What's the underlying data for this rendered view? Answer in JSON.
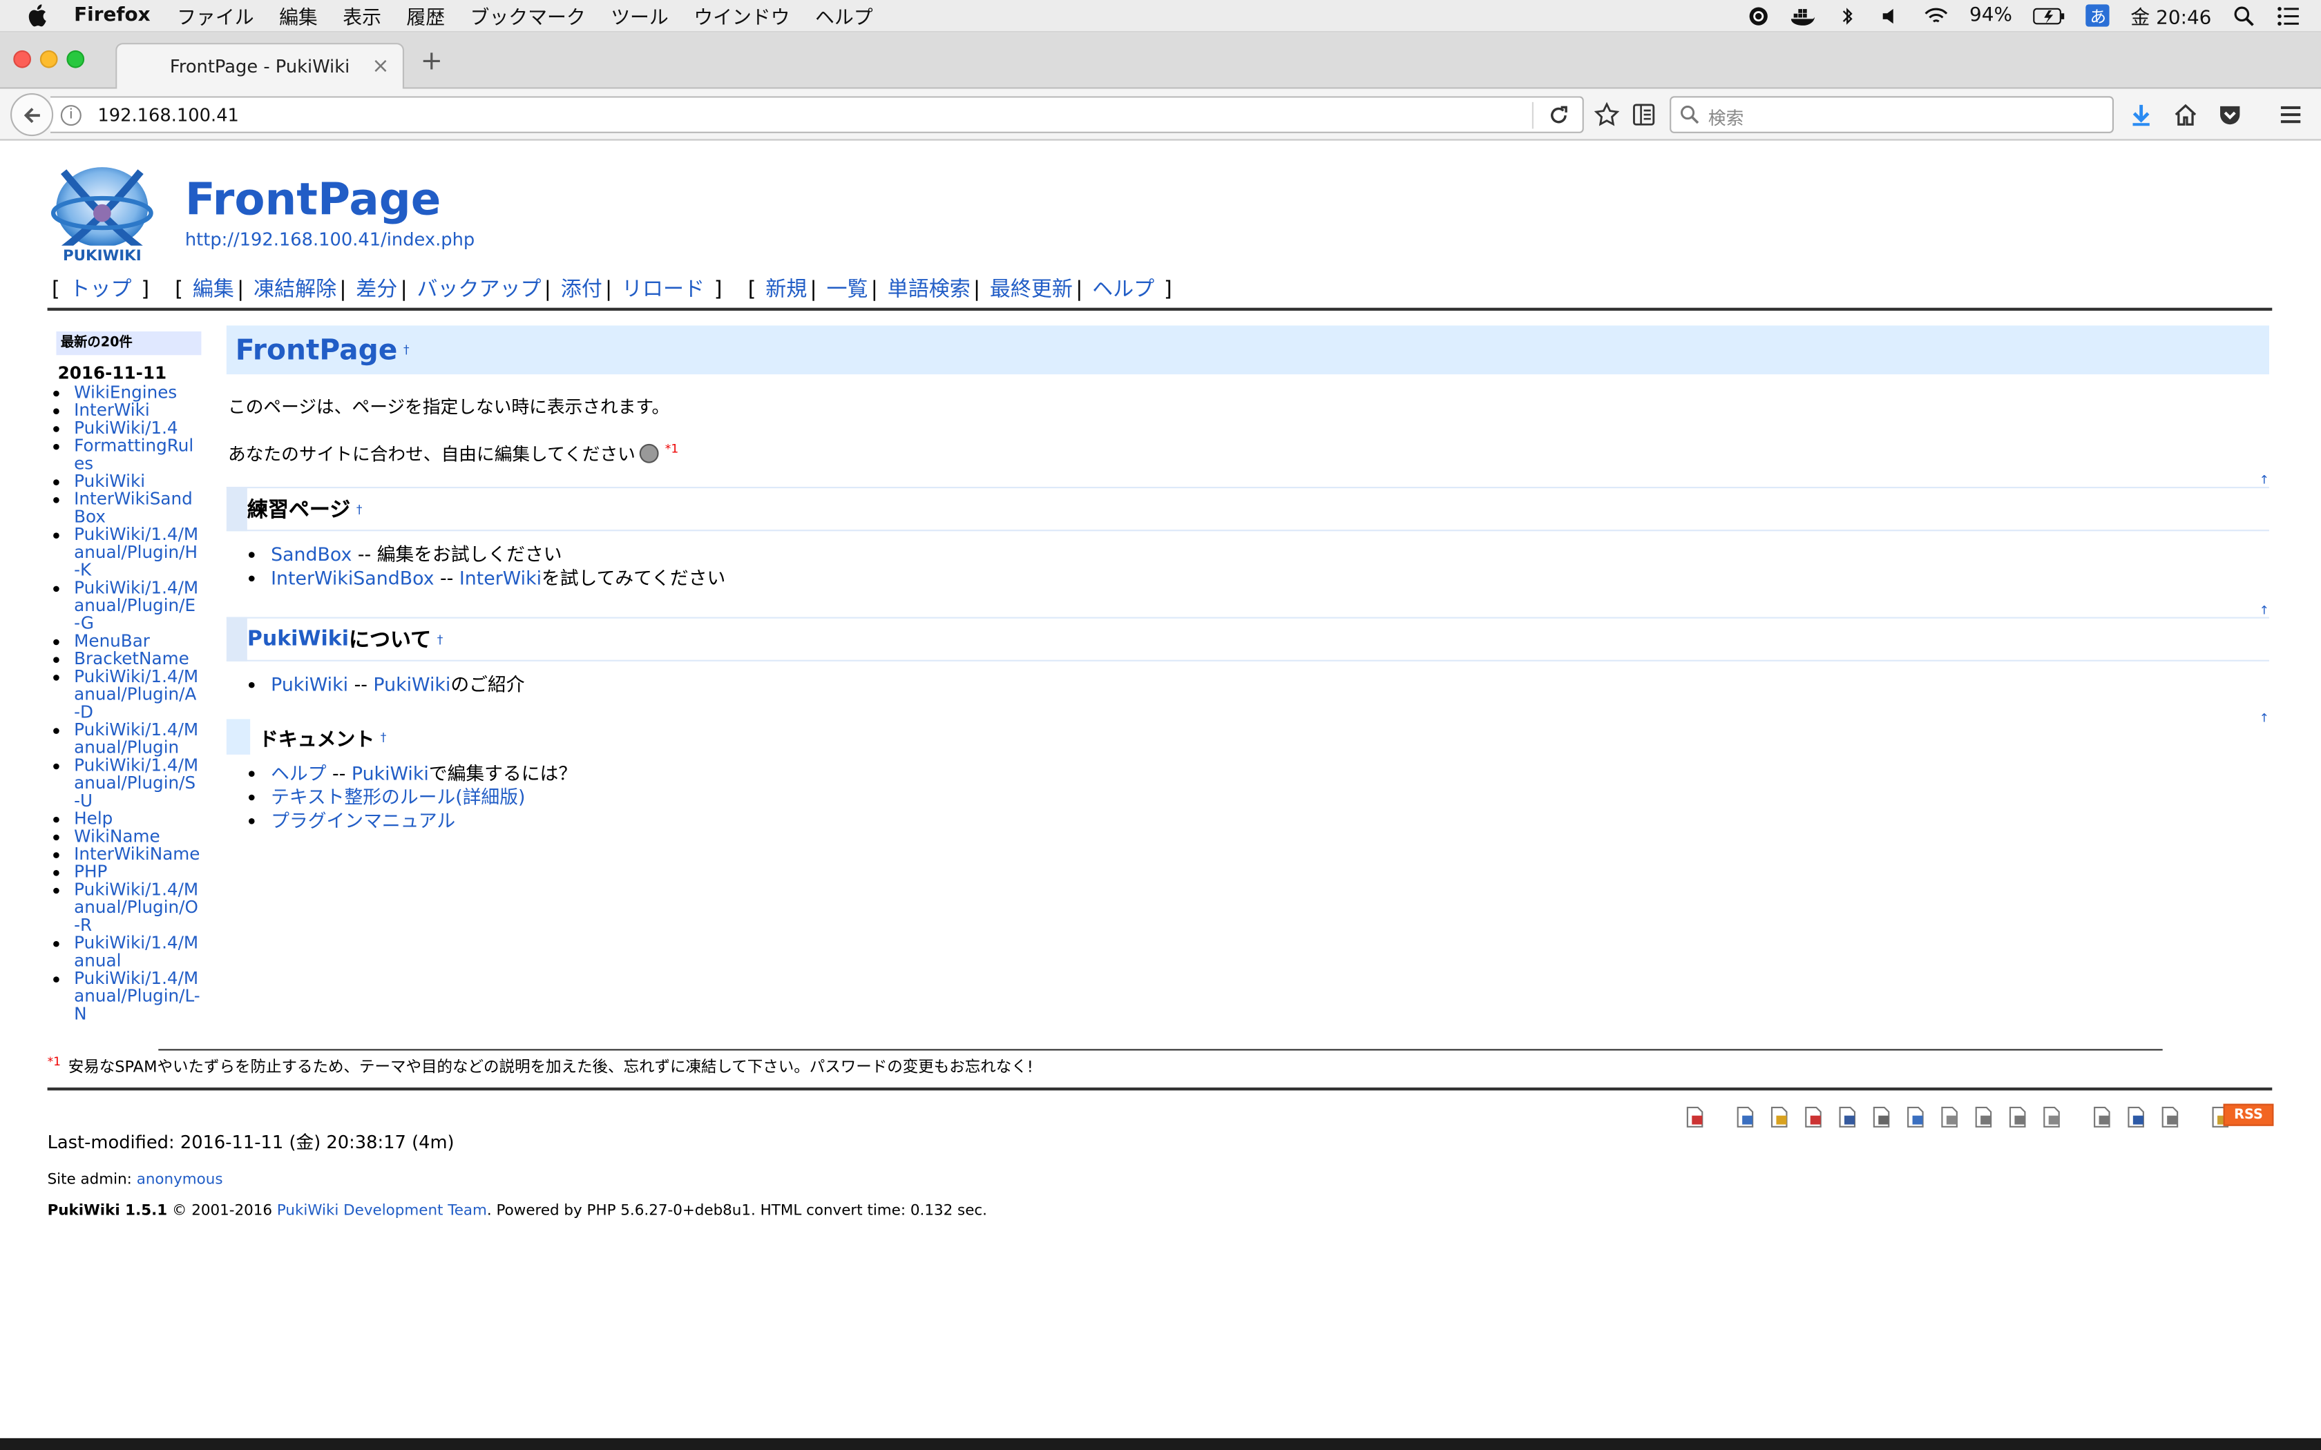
{
  "menubar": {
    "app_name": "Firefox",
    "menus": [
      "ファイル",
      "編集",
      "表示",
      "履歴",
      "ブックマーク",
      "ツール",
      "ウインドウ",
      "ヘルプ"
    ],
    "battery": "94%",
    "ime": "あ",
    "clock": "金 20:46"
  },
  "browser": {
    "tab_title": "FrontPage - PukiWiki",
    "tab_close": "×",
    "new_tab": "+",
    "url": "192.168.100.41",
    "info": "i",
    "search_placeholder": "検索"
  },
  "wiki": {
    "logo_text": "PUKIWIKI",
    "title": "FrontPage",
    "page_url": "http://192.168.100.41/index.php",
    "nav_groups": [
      [
        "トップ"
      ],
      [
        "編集",
        "凍結解除",
        "差分",
        "バックアップ",
        "添付",
        "リロード"
      ],
      [
        "新規",
        "一覧",
        "単語検索",
        "最終更新",
        "ヘルプ"
      ]
    ],
    "side": {
      "heading": "最新の20件",
      "date": "2016-11-11",
      "items": [
        "WikiEngines",
        "InterWiki",
        "PukiWiki/1.4",
        "FormattingRules",
        "PukiWiki",
        "InterWikiSandBox",
        "PukiWiki/1.4/Manual/Plugin/H-K",
        "PukiWiki/1.4/Manual/Plugin/E-G",
        "MenuBar",
        "BracketName",
        "PukiWiki/1.4/Manual/Plugin/A-D",
        "PukiWiki/1.4/Manual/Plugin",
        "PukiWiki/1.4/Manual/Plugin/S-U",
        "Help",
        "WikiName",
        "InterWikiName",
        "PHP",
        "PukiWiki/1.4/Manual/Plugin/O-R",
        "PukiWiki/1.4/Manual",
        "PukiWiki/1.4/Manual/Plugin/L-N"
      ]
    },
    "body": {
      "h2": "FrontPage",
      "anchor": "†",
      "p1": "このページは、ページを指定しない時に表示されます。",
      "p2": "あなたのサイトに合わせ、自由に編集してください",
      "fn_mark": "*1",
      "jump": "↑",
      "sec1_title": "練習ページ",
      "sec1_items": [
        {
          "link": "SandBox",
          "sep": " -- ",
          "text": "編集をお試しください"
        },
        {
          "link": "InterWikiSandBox",
          "sep": " -- ",
          "link2": "InterWiki",
          "text": "を試してみてください"
        }
      ],
      "sec2_link": "PukiWiki",
      "sec2_rest": "について",
      "sec2_items": [
        {
          "link": "PukiWiki",
          "sep": " -- ",
          "link2": "PukiWiki",
          "text": "のご紹介"
        }
      ],
      "sec3_title": "ドキュメント",
      "sec3_items": [
        {
          "link": "ヘルプ",
          "sep": " -- ",
          "link2": "PukiWiki",
          "text": "で編集するには？"
        },
        {
          "link": "テキスト整形のルール(詳細版)"
        },
        {
          "link": "プラグインマニュアル"
        }
      ]
    },
    "footnote": {
      "mark": "*1",
      "text": "安易なSPAMやいたずらを防止するため、テーマや目的などの説明を加えた後、忘れずに凍結して下さい。パスワードの変更もお忘れなく!"
    },
    "toolbar_icons": [
      "top-icon",
      "edit-icon",
      "freeze-icon",
      "diff-icon",
      "backup-icon",
      "upload-icon",
      "copy-icon",
      "new-icon",
      "list-icon",
      "reload-icon",
      "list-page-icon",
      "attach-list-icon",
      "search-icon",
      "recent-icon",
      "help-icon"
    ],
    "rss": "RSS",
    "last_modified": "Last-modified: 2016-11-11 (金) 20:38:17 (4m)",
    "site_admin_label": "Site admin: ",
    "site_admin": "anonymous",
    "footer_version": "PukiWiki 1.5.1",
    "footer_copy": " © 2001-2016 ",
    "footer_team": "PukiWiki Development Team",
    "footer_rest": ". Powered by PHP 5.6.27-0+deb8u1. HTML convert time: 0.132 sec."
  },
  "colors": {
    "link": "#215dc6",
    "heading_bg": "#ddeeff",
    "rss": "#f26522"
  }
}
